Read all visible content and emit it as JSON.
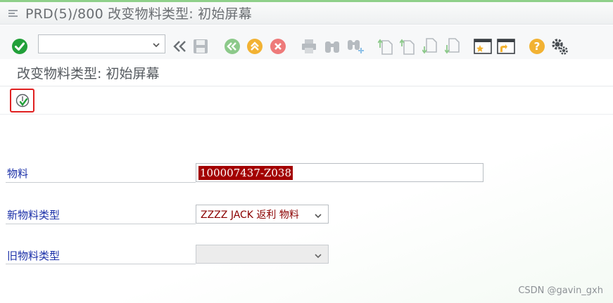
{
  "window": {
    "title": "PRD(5)/800 改变物料类型: 初始屏幕"
  },
  "toolbar": {
    "command_field_value": "",
    "icons": [
      "enter-icon",
      "back-icon",
      "save-icon",
      "back-green-icon",
      "exit-icon",
      "cancel-icon",
      "print-icon",
      "find-icon",
      "find-next-icon",
      "first-page-icon",
      "previous-page-icon",
      "next-page-icon",
      "last-page-icon",
      "new-session-icon",
      "shortcut-icon",
      "help-icon",
      "settings-icon"
    ]
  },
  "screen": {
    "title": "改变物料类型: 初始屏幕"
  },
  "app_toolbar": {
    "execute_icon": "execute-icon"
  },
  "form": {
    "material_label": "物料",
    "material_value": "100007437-Z038",
    "new_type_label": "新物料类型",
    "new_type_value": "ZZZZ JACK 返利 物料",
    "old_type_label": "旧物料类型",
    "old_type_value": ""
  },
  "watermark": "CSDN @gavin_gxh",
  "colors": {
    "accent_green": "#22a03a",
    "highlight_red": "#a30000",
    "label_blue": "#1a2fa8",
    "frame_red": "#e02020"
  }
}
